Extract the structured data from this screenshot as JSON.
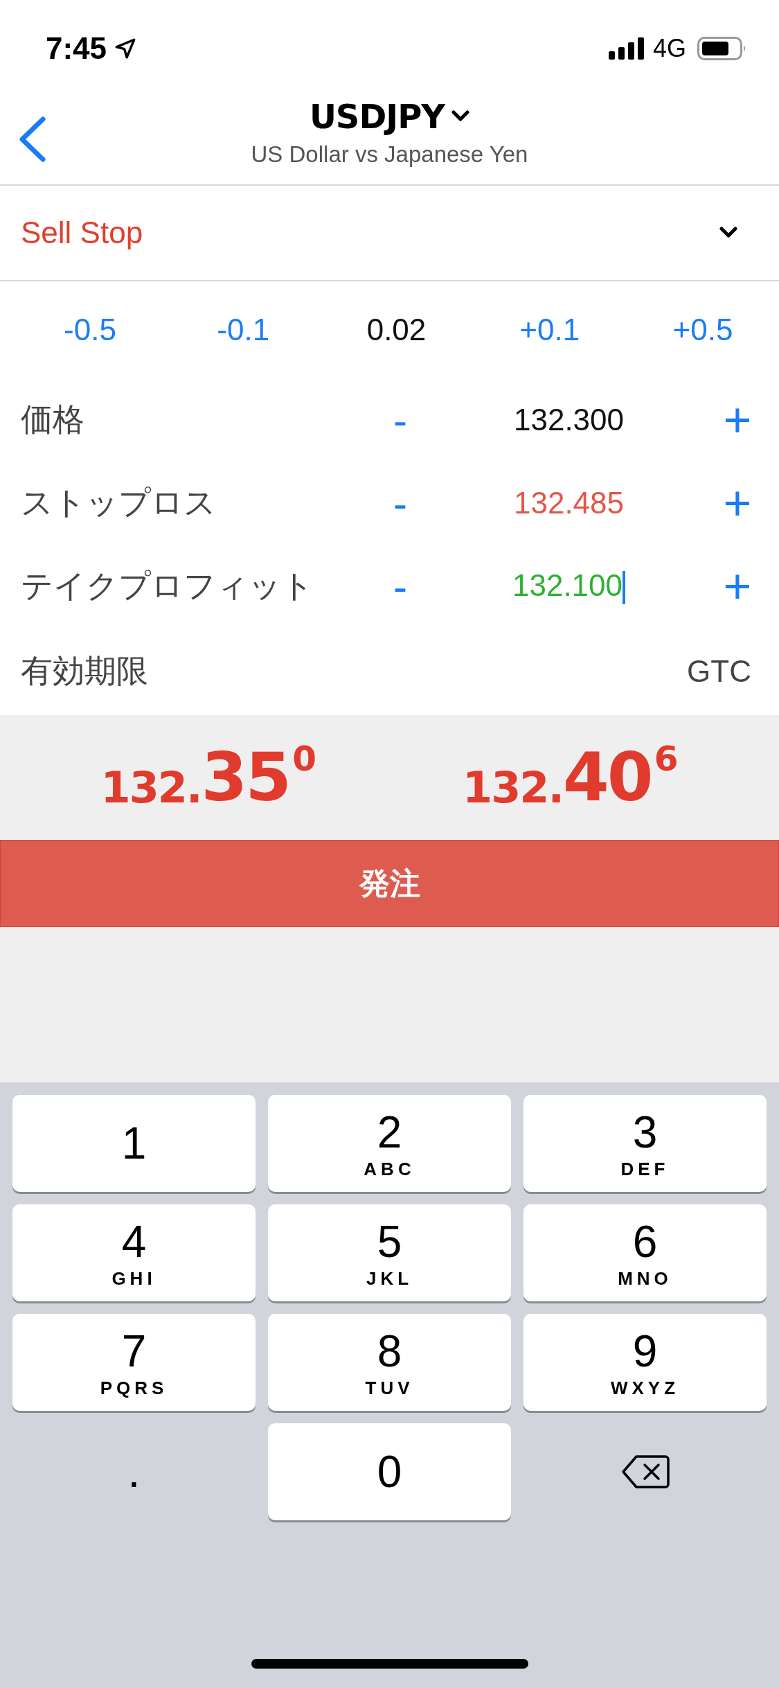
{
  "status_bar": {
    "time": "7:45",
    "network": "4G"
  },
  "header": {
    "symbol": "USDJPY",
    "description": "US Dollar vs Japanese Yen"
  },
  "order_type": {
    "label": "Sell Stop"
  },
  "volume_steps": [
    {
      "label": "-0.5",
      "kind": "step"
    },
    {
      "label": "-0.1",
      "kind": "step"
    },
    {
      "label": "0.02",
      "kind": "value"
    },
    {
      "label": "+0.1",
      "kind": "step"
    },
    {
      "label": "+0.5",
      "kind": "step"
    }
  ],
  "fields": [
    {
      "label": "価格",
      "minus": "-",
      "value": "132.300",
      "plus": "+",
      "color": "#111111",
      "focused": false
    },
    {
      "label": "ストップロス",
      "minus": "-",
      "value": "132.485",
      "plus": "+",
      "color": "#e0584a",
      "focused": false
    },
    {
      "label": "テイクプロフィット",
      "minus": "-",
      "value": "132.100",
      "plus": "+",
      "color": "#2eb135",
      "focused": true
    }
  ],
  "expiry": {
    "label": "有効期限",
    "value": "GTC"
  },
  "quotes": [
    {
      "prefix": "132.",
      "big": "35",
      "sup": "0"
    },
    {
      "prefix": "132.",
      "big": "40",
      "sup": "6"
    }
  ],
  "order_button": {
    "label": "発注"
  },
  "keypad": [
    {
      "digit": "1",
      "kind": "key"
    },
    {
      "digit": "2",
      "letters": "ABC",
      "kind": "key"
    },
    {
      "digit": "3",
      "letters": "DEF",
      "kind": "key"
    },
    {
      "digit": "4",
      "letters": "GHI",
      "kind": "key"
    },
    {
      "digit": "5",
      "letters": "JKL",
      "kind": "key"
    },
    {
      "digit": "6",
      "letters": "MNO",
      "kind": "key"
    },
    {
      "digit": "7",
      "letters": "PQRS",
      "kind": "key"
    },
    {
      "digit": "8",
      "letters": "TUV",
      "kind": "key"
    },
    {
      "digit": "9",
      "letters": "WXYZ",
      "kind": "key"
    },
    {
      "digit": ".",
      "kind": "plain"
    },
    {
      "digit": "0",
      "kind": "key"
    },
    {
      "kind": "delete"
    }
  ]
}
